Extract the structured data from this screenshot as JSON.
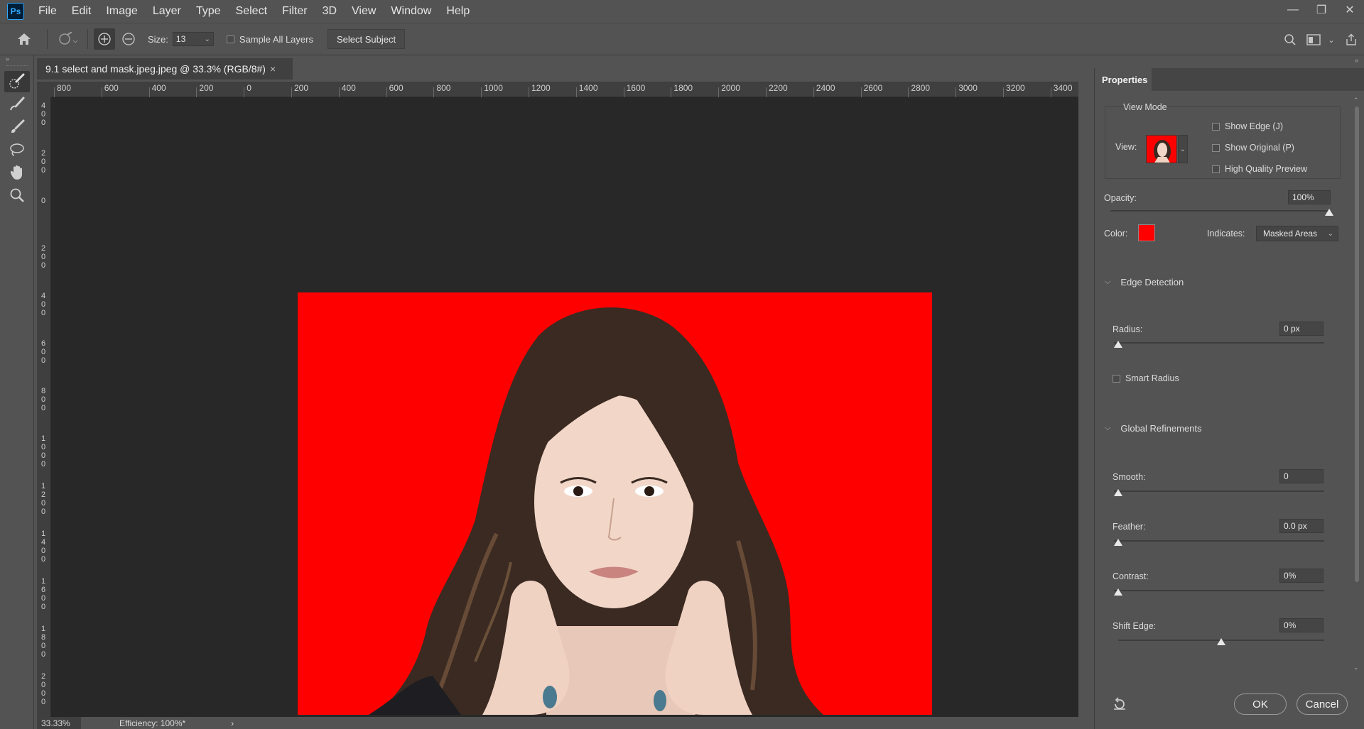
{
  "menubar": {
    "logo": "Ps",
    "items": [
      "File",
      "Edit",
      "Image",
      "Layer",
      "Type",
      "Select",
      "Filter",
      "3D",
      "View",
      "Window",
      "Help"
    ]
  },
  "window": {
    "minimize": "—",
    "restore": "❐",
    "close": "✕"
  },
  "options": {
    "size_label": "Size:",
    "size_value": "13",
    "sample_all_layers": "Sample All Layers",
    "select_subject": "Select Subject"
  },
  "document": {
    "tab_title": "9.1 select and mask.jpeg.jpeg @ 33.3% (RGB/8#)",
    "tab_close": "×"
  },
  "ruler": {
    "h_labels": [
      "800",
      "600",
      "400",
      "200",
      "0",
      "200",
      "400",
      "600",
      "800",
      "1000",
      "1200",
      "1400",
      "1600",
      "1800",
      "2000",
      "2200",
      "2400",
      "2600",
      "2800",
      "3000",
      "3200",
      "3400"
    ],
    "v_labels": [
      "400",
      "200",
      "0",
      "200",
      "400",
      "600",
      "800",
      "1000",
      "1200",
      "1400",
      "1600",
      "1800",
      "2000"
    ]
  },
  "status": {
    "zoom": "33.33%",
    "efficiency": "Efficiency: 100%*",
    "arrow": "›"
  },
  "properties": {
    "tab": "Properties",
    "view_mode_title": "View Mode",
    "view_label": "View:",
    "show_edge": "Show Edge (J)",
    "show_original": "Show Original (P)",
    "high_quality": "High Quality Preview",
    "opacity_label": "Opacity:",
    "opacity_value": "100%",
    "opacity_level": 1.0,
    "color_label": "Color:",
    "overlay_color": "#ff0000",
    "indicates_label": "Indicates:",
    "indicates_value": "Masked Areas",
    "edge_detection": "Edge Detection",
    "radius_label": "Radius:",
    "radius_value": "0 px",
    "smart_radius": "Smart Radius",
    "global_refinements": "Global Refinements",
    "smooth_label": "Smooth:",
    "smooth_value": "0",
    "feather_label": "Feather:",
    "feather_value": "0.0 px",
    "contrast_label": "Contrast:",
    "contrast_value": "0%",
    "shift_edge_label": "Shift Edge:",
    "shift_edge_value": "0%",
    "ok": "OK",
    "cancel": "Cancel"
  }
}
